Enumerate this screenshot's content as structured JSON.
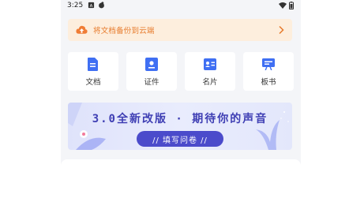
{
  "status_bar": {
    "time": "3:25",
    "left_icons": [
      "a-box-icon",
      "gallery-icon"
    ],
    "right_icons": [
      "wifi-icon",
      "battery-icon"
    ]
  },
  "backup_banner": {
    "text": "将文档备份到云端",
    "icon": "cloud-upload-icon",
    "accent_color": "#e77b2c",
    "background": "#fdeedd"
  },
  "quick_actions": [
    {
      "label": "文档",
      "icon": "document-icon"
    },
    {
      "label": "证件",
      "icon": "id-card-icon"
    },
    {
      "label": "名片",
      "icon": "business-card-icon"
    },
    {
      "label": "板书",
      "icon": "board-icon"
    }
  ],
  "promo": {
    "title": "3.0全新改版 · 期待你的声音",
    "button_label": "// 填写问卷 //",
    "accent_color": "#4b4bcb"
  },
  "icon_color": "#3f6ff3"
}
